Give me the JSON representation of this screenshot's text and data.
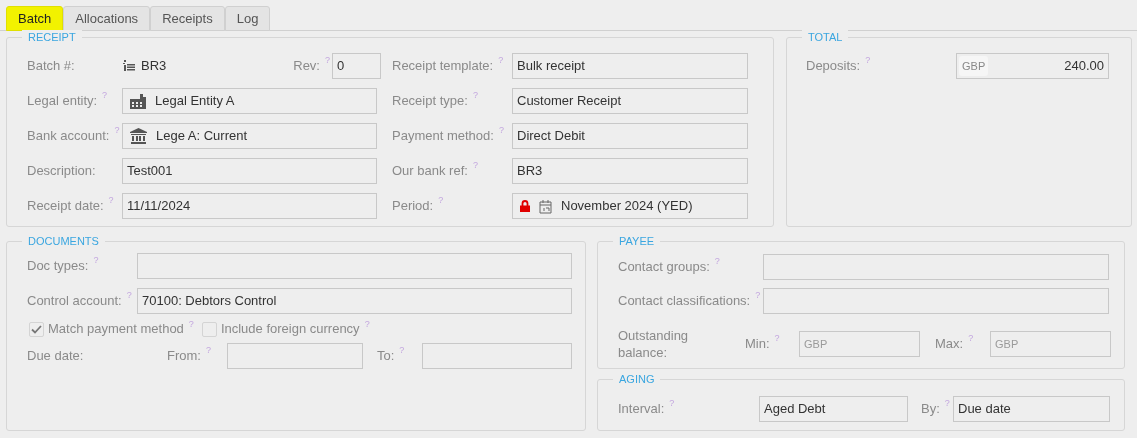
{
  "tabs": [
    {
      "label": "Batch",
      "selected": true
    },
    {
      "label": "Allocations",
      "selected": false
    },
    {
      "label": "Receipts",
      "selected": false
    },
    {
      "label": "Log",
      "selected": false
    }
  ],
  "receipt": {
    "title": "RECEIPT",
    "batch": {
      "label": "Batch #:",
      "value": "BR3",
      "rev_label": "Rev:",
      "rev_help": "?",
      "rev_value": "0"
    },
    "left": [
      {
        "label": "Legal entity:",
        "help": "?",
        "kind": "entity",
        "value": "Legal Entity A"
      },
      {
        "label": "Bank account:",
        "help": "?",
        "kind": "bank",
        "value": "Lege A: Current"
      },
      {
        "label": "Description:",
        "value": "Test001"
      },
      {
        "label": "Receipt date:",
        "help": "?",
        "value": "11/11/2024"
      }
    ],
    "right": [
      {
        "label": "Receipt template:",
        "help": "?",
        "value": "Bulk receipt"
      },
      {
        "label": "Receipt type:",
        "help": "?",
        "value": "Customer Receipt"
      },
      {
        "label": "Payment method:",
        "help": "?",
        "value": "Direct Debit"
      },
      {
        "label": "Our bank ref:",
        "help": "?",
        "value": "BR3"
      },
      {
        "label": "Period:",
        "help": "?",
        "locked": true,
        "kind": "period",
        "value": "November 2024 (YED)"
      }
    ]
  },
  "total": {
    "title": "TOTAL",
    "label": "Deposits:",
    "help": "?",
    "currency": "GBP",
    "value": "240.00"
  },
  "documents": {
    "title": "DOCUMENTS",
    "fields": [
      {
        "label": "Doc types:",
        "help": "?"
      },
      {
        "label": "Control account:",
        "help": "?",
        "value": "70100: Debtors Control"
      }
    ],
    "checkboxes": [
      {
        "label": "Match payment method",
        "help": "?",
        "checked": true
      },
      {
        "label": "Include foreign currency",
        "help": "?",
        "checked": false
      }
    ],
    "due_date": {
      "label": "Due date:",
      "from_label": "From:",
      "from_help": "?",
      "to_label": "To:",
      "to_help": "?"
    }
  },
  "payee": {
    "title": "PAYEE",
    "fields": [
      {
        "label": "Contact groups:",
        "help": "?"
      },
      {
        "label": "Contact classifications:",
        "help": "?"
      }
    ],
    "balance": {
      "label": "Outstanding balance:",
      "min_label": "Min:",
      "min_help": "?",
      "min_placeholder": "GBP",
      "max_label": "Max:",
      "max_help": "?",
      "max_placeholder": "GBP"
    }
  },
  "aging": {
    "title": "AGING",
    "interval_label": "Interval:",
    "interval_help": "?",
    "interval_value": "Aged Debt",
    "by_label": "By:",
    "by_help": "?",
    "by_value": "Due date"
  }
}
